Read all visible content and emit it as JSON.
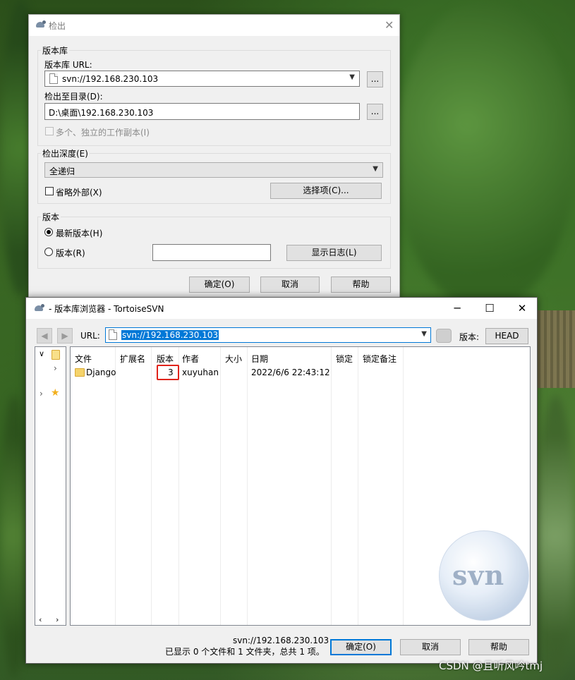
{
  "checkout_dialog": {
    "title": "检出",
    "repo_group": "版本库",
    "repo_url_label": "版本库 URL:",
    "repo_url_value": "svn://192.168.230.103",
    "browse_label": "...",
    "checkout_dir_label": "检出至目录(D):",
    "checkout_dir_value": "D:\\桌面\\192.168.230.103",
    "multiple_copies_label": "多个、独立的工作副本(I)",
    "depth_group": "检出深度(E)",
    "depth_value": "全递归",
    "omit_externals_label": "省略外部(X)",
    "choose_items_label": "选择项(C)...",
    "revision_group": "版本",
    "head_revision_label": "最新版本(H)",
    "revision_label": "版本(R)",
    "revision_value": "",
    "show_log_label": "显示日志(L)",
    "ok_label": "确定(O)",
    "cancel_label": "取消",
    "help_label": "帮助"
  },
  "repo_browser": {
    "title": "- 版本库浏览器 - TortoiseSVN",
    "url_label": "URL:",
    "url_value": "svn://192.168.230.103",
    "revision_label": "版本:",
    "revision_button": "HEAD",
    "columns": [
      "文件",
      "扩展名",
      "版本",
      "作者",
      "大小",
      "日期",
      "锁定",
      "锁定备注"
    ],
    "rows": [
      {
        "name": "Django",
        "ext": "",
        "revision": "3",
        "author": "xuyuhan",
        "size": "",
        "date": "2022/6/6 22:43:12",
        "lock": "",
        "lock_comment": ""
      }
    ],
    "status_url": "svn://192.168.230.103",
    "status_summary": "已显示 0 个文件和 1 文件夹，总共 1 项。",
    "ok_label": "确定(O)",
    "cancel_label": "取消",
    "help_label": "帮助",
    "logo_text": "svn"
  },
  "watermark": "CSDN @且听风吟tmj",
  "colors": {
    "accent": "#0078d7",
    "highlight": "#e0231b",
    "folder": "#f5d36b"
  }
}
